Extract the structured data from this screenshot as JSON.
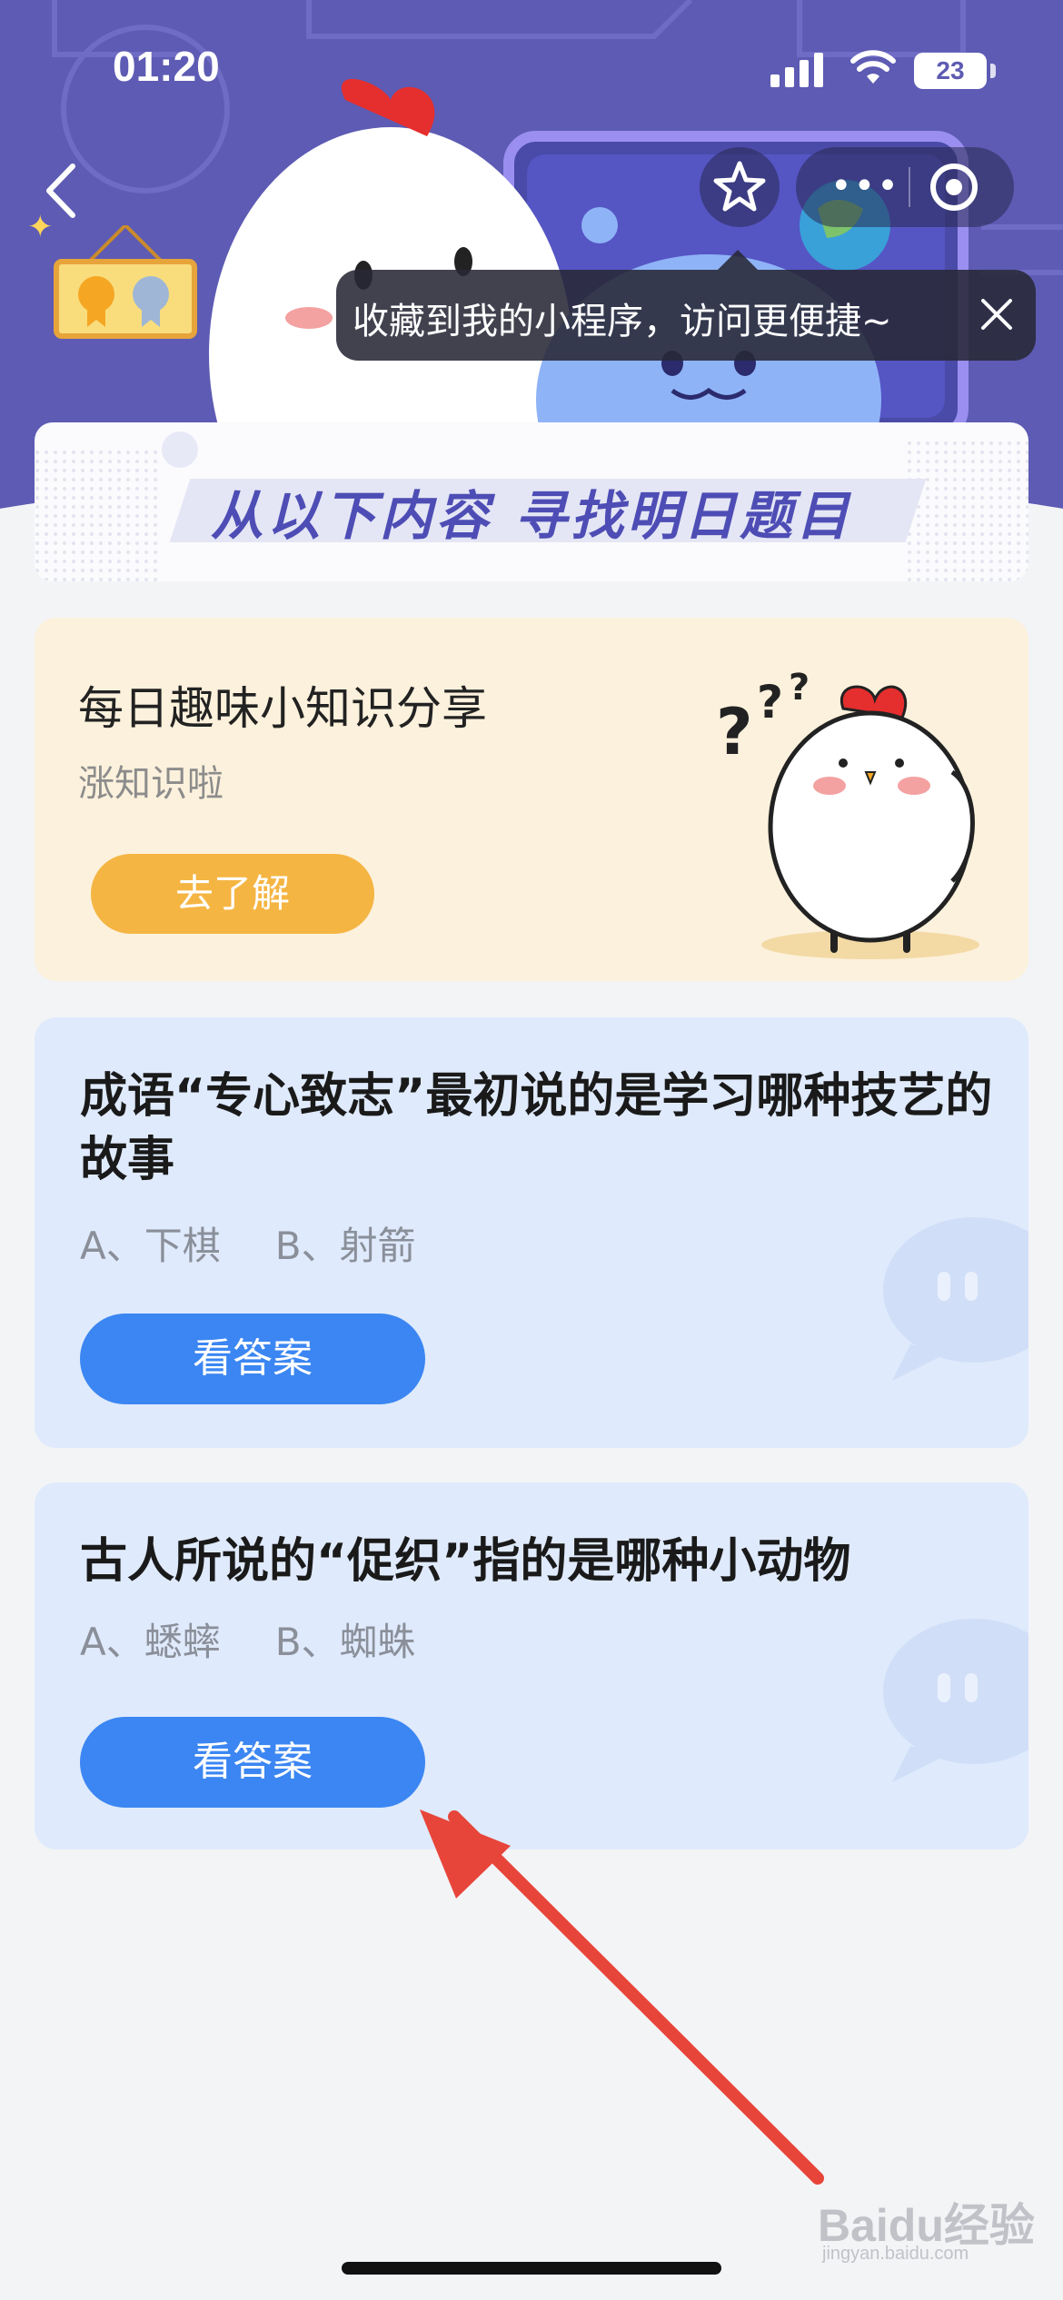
{
  "status_bar": {
    "time": "01:20",
    "battery": "23"
  },
  "header": {
    "tooltip_text": "收藏到我的小程序，访问更便捷~",
    "banner_text": "从以下内容  寻找明日题目"
  },
  "tips_card": {
    "title": "每日趣味小知识分享",
    "subtitle": "涨知识啦",
    "button_label": "去了解"
  },
  "questions": [
    {
      "title": "成语“专心致志”最初说的是学习哪种技艺的故事",
      "option_a": "A、下棋",
      "option_b": "B、射箭",
      "button_label": "看答案"
    },
    {
      "title": "古人所说的“促织”指的是哪种小动物",
      "option_a": "A、蟋蟀",
      "option_b": "B、蜘蛛",
      "button_label": "看答案"
    }
  ],
  "watermark": {
    "text": "Baidu经验",
    "sub": "jingyan.baidu.com"
  },
  "colors": {
    "header": "#5d5bb3",
    "accent_blue": "#3b86f2",
    "accent_orange": "#f5b543",
    "arrow_red": "#e8453a"
  }
}
